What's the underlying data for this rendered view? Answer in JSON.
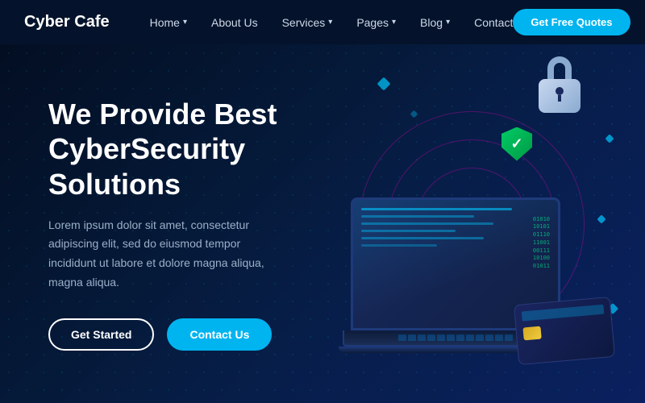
{
  "brand": {
    "name": "Cyber Cafe"
  },
  "navbar": {
    "items": [
      {
        "label": "Home",
        "has_dropdown": true
      },
      {
        "label": "About Us",
        "has_dropdown": false
      },
      {
        "label": "Services",
        "has_dropdown": true
      },
      {
        "label": "Pages",
        "has_dropdown": true
      },
      {
        "label": "Blog",
        "has_dropdown": true
      },
      {
        "label": "Contact",
        "has_dropdown": false
      }
    ],
    "cta_label": "Get Free Quotes"
  },
  "hero": {
    "title": "We Provide Best CyberSecurity Solutions",
    "subtitle": "Lorem ipsum dolor sit amet, consectetur adipiscing elit, sed do eiusmod tempor incididunt ut labore et dolore magna aliqua, magna aliqua.",
    "btn_started": "Get Started",
    "btn_contact": "Contact Us"
  }
}
